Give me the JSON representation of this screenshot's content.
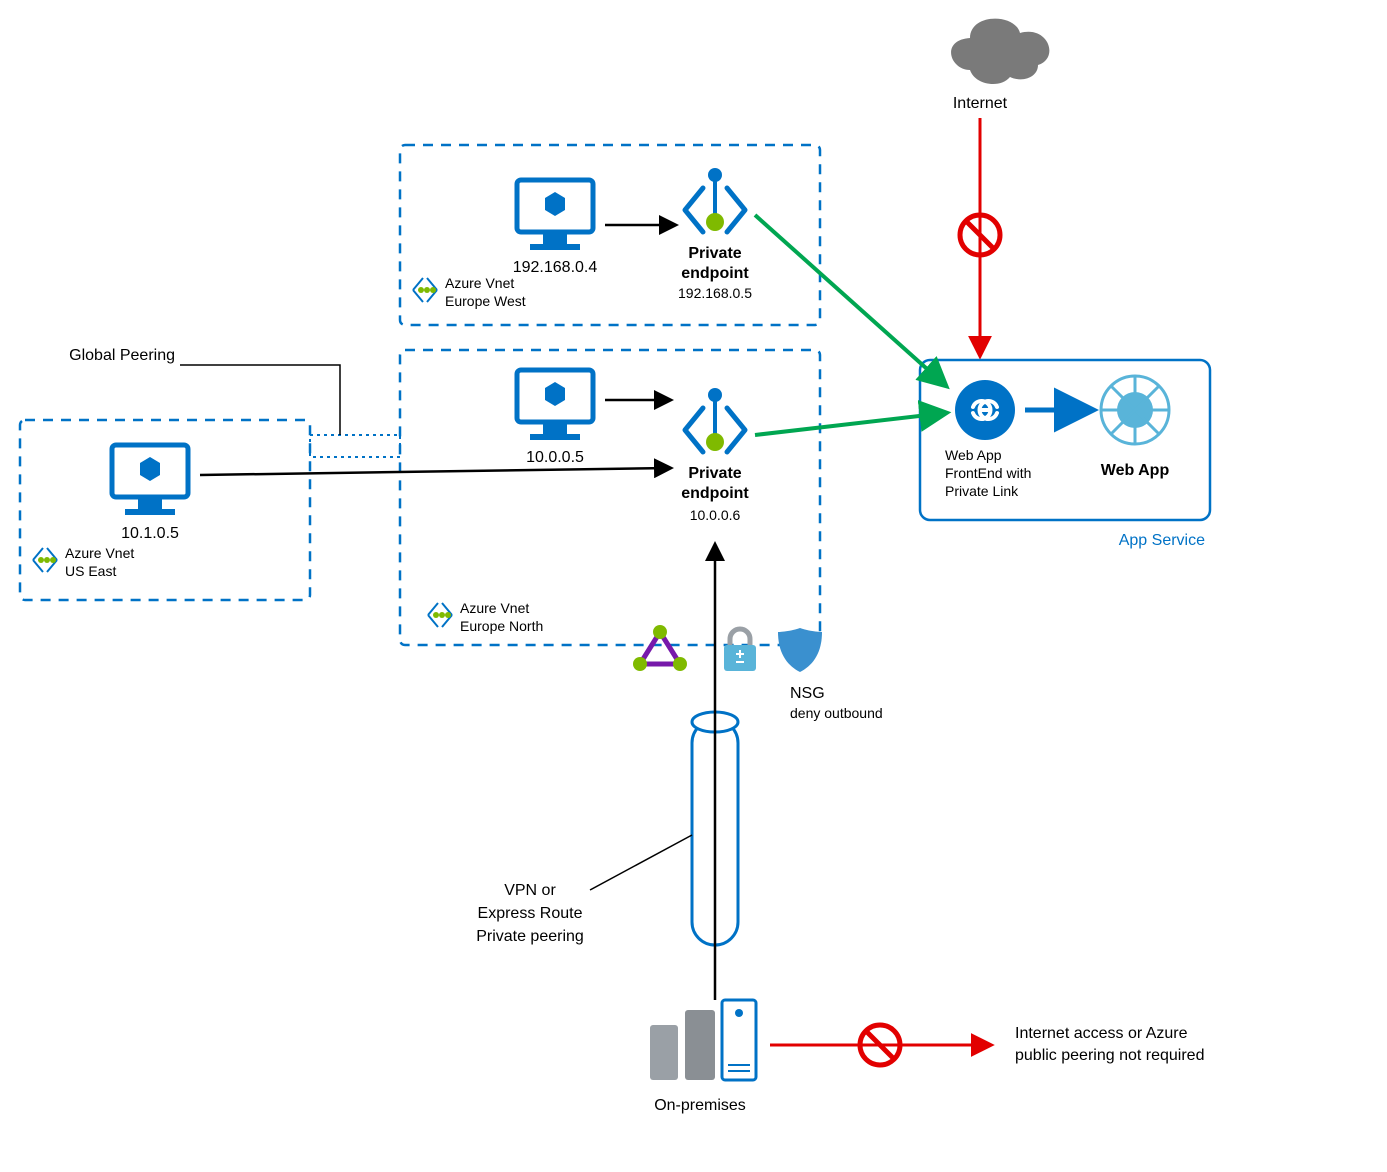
{
  "internet": {
    "label": "Internet"
  },
  "appService": {
    "groupLabel": "App Service",
    "frontend": {
      "line1": "Web App",
      "line2": "FrontEnd with",
      "line3": "Private Link"
    },
    "webapp": {
      "label": "Web App"
    }
  },
  "vnetEuropeWest": {
    "title1": "Azure Vnet",
    "title2": "Europe West",
    "vm_ip": "192.168.0.4",
    "pe": {
      "label1": "Private",
      "label2": "endpoint",
      "ip": "192.168.0.5"
    }
  },
  "vnetEuropeNorth": {
    "title1": "Azure Vnet",
    "title2": "Europe North",
    "vm_ip": "10.0.0.5",
    "pe": {
      "label1": "Private",
      "label2": "endpoint",
      "ip": "10.0.0.6"
    }
  },
  "vnetUSEast": {
    "title1": "Azure Vnet",
    "title2": "US East",
    "vm_ip": "10.1.0.5"
  },
  "nsg": {
    "label": "NSG",
    "sub": "deny outbound"
  },
  "globalPeering": {
    "label": "Global Peering"
  },
  "vpn": {
    "line1": "VPN or",
    "line2": "Express Route",
    "line3": "Private peering"
  },
  "onprem": {
    "label": "On-premises",
    "note1": "Internet access or Azure",
    "note2": "public peering not required"
  }
}
